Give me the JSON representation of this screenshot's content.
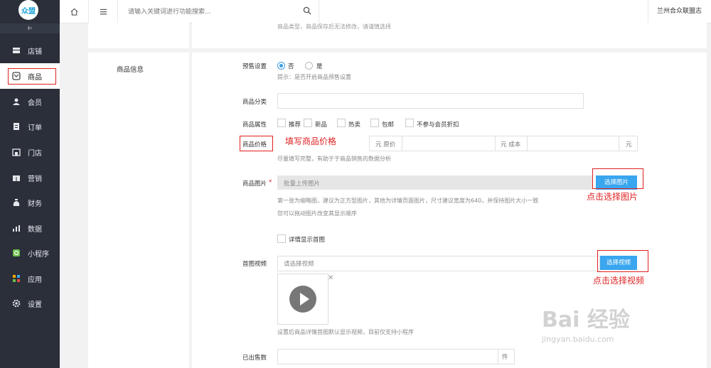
{
  "sidebar": {
    "logo_text": "众盟",
    "items": [
      {
        "label": "店铺",
        "icon": "store-icon"
      },
      {
        "label": "商品",
        "icon": "goods-icon"
      },
      {
        "label": "会员",
        "icon": "user-icon"
      },
      {
        "label": "订单",
        "icon": "order-icon"
      },
      {
        "label": "门店",
        "icon": "shop-icon"
      },
      {
        "label": "营销",
        "icon": "gift-icon"
      },
      {
        "label": "财务",
        "icon": "money-icon"
      },
      {
        "label": "数据",
        "icon": "chart-icon"
      },
      {
        "label": "小程序",
        "icon": "miniprogram-icon"
      },
      {
        "label": "应用",
        "icon": "apps-icon"
      },
      {
        "label": "设置",
        "icon": "gear-icon"
      }
    ],
    "active_index": 1
  },
  "topbar": {
    "search_placeholder": "请输入关键词进行功能搜索...",
    "company": "兰州合众联盟志"
  },
  "form": {
    "type_hint": "商品类型，商品保存后无法修改，请谨慎选择",
    "section_title": "商品信息",
    "presale": {
      "label": "预售设置",
      "option_no": "否",
      "option_yes": "是",
      "selected": "否",
      "hint": "提示：是否开启商品预售设置"
    },
    "category": {
      "label": "商品分类",
      "value": ""
    },
    "attributes": {
      "label": "商品属性",
      "options": [
        "推荐",
        "新品",
        "热卖",
        "包邮",
        "不参与会员折扣"
      ]
    },
    "price": {
      "label": "商品价格",
      "unit1": "元 原价",
      "unit2": "元 成本",
      "unit3": "元",
      "hint": "尽量填写完整，有助于于商品销售的数据分析"
    },
    "images": {
      "label": "商品图片",
      "required_mark": "*",
      "placeholder": "批量上传图片",
      "button": "选择图片",
      "hint1": "第一张为缩略图，建议为正方型图片，其他为详情页面图片，尺寸建议宽度为640，并保持图片大小一致",
      "hint2": "您可以拖动图片改变其显示顺序",
      "detail_first": "详情显示首图"
    },
    "video": {
      "label": "首图视频",
      "placeholder": "请选择视频",
      "button": "选择视频",
      "hint": "设置后商品详情首图默认显示视频，目前仅支持小程序"
    },
    "sold": {
      "label": "已出售数",
      "unit": "件"
    }
  },
  "annotations": {
    "price_note": "填写商品价格",
    "image_note": "点击选择图片",
    "video_note": "点击选择视频"
  },
  "watermark": {
    "big": "Bai 经验",
    "small": "jingyan.baidu.com"
  },
  "colors": {
    "sidebar_bg": "#2b2f3a",
    "accent": "#3aa6ef",
    "annotation_red": "#e02020"
  }
}
